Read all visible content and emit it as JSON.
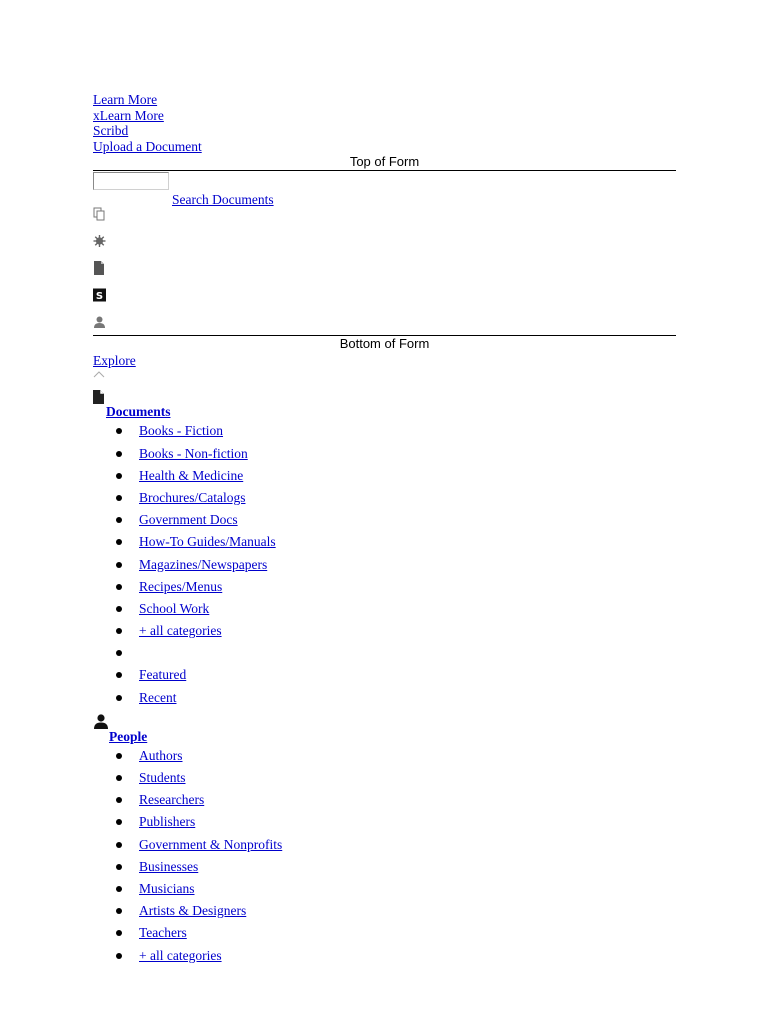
{
  "top_links": [
    "Learn More",
    "xLearn More",
    "Scribd",
    "Upload a Document"
  ],
  "form": {
    "top_label": "Top of Form",
    "bottom_label": "Bottom of Form",
    "search_value": "",
    "search_link": "Search Documents",
    "icons": [
      "documents-icon",
      "gear-icon",
      "page-icon",
      "scribd-logo-icon",
      "person-icon"
    ]
  },
  "explore_label": "Explore",
  "documents": {
    "title": "Documents",
    "items": [
      "Books - Fiction",
      "Books - Non-fiction",
      "Health & Medicine",
      "Brochures/Catalogs",
      "Government Docs",
      "How-To Guides/Manuals",
      "Magazines/Newspapers",
      "Recipes/Menus",
      "School Work",
      "+ all categories",
      "",
      "Featured",
      "Recent"
    ]
  },
  "people": {
    "title": "People",
    "items": [
      "Authors",
      "Students",
      "Researchers",
      "Publishers",
      "Government & Nonprofits",
      "Businesses",
      "Musicians",
      "Artists & Designers",
      "Teachers",
      "+ all categories"
    ]
  }
}
